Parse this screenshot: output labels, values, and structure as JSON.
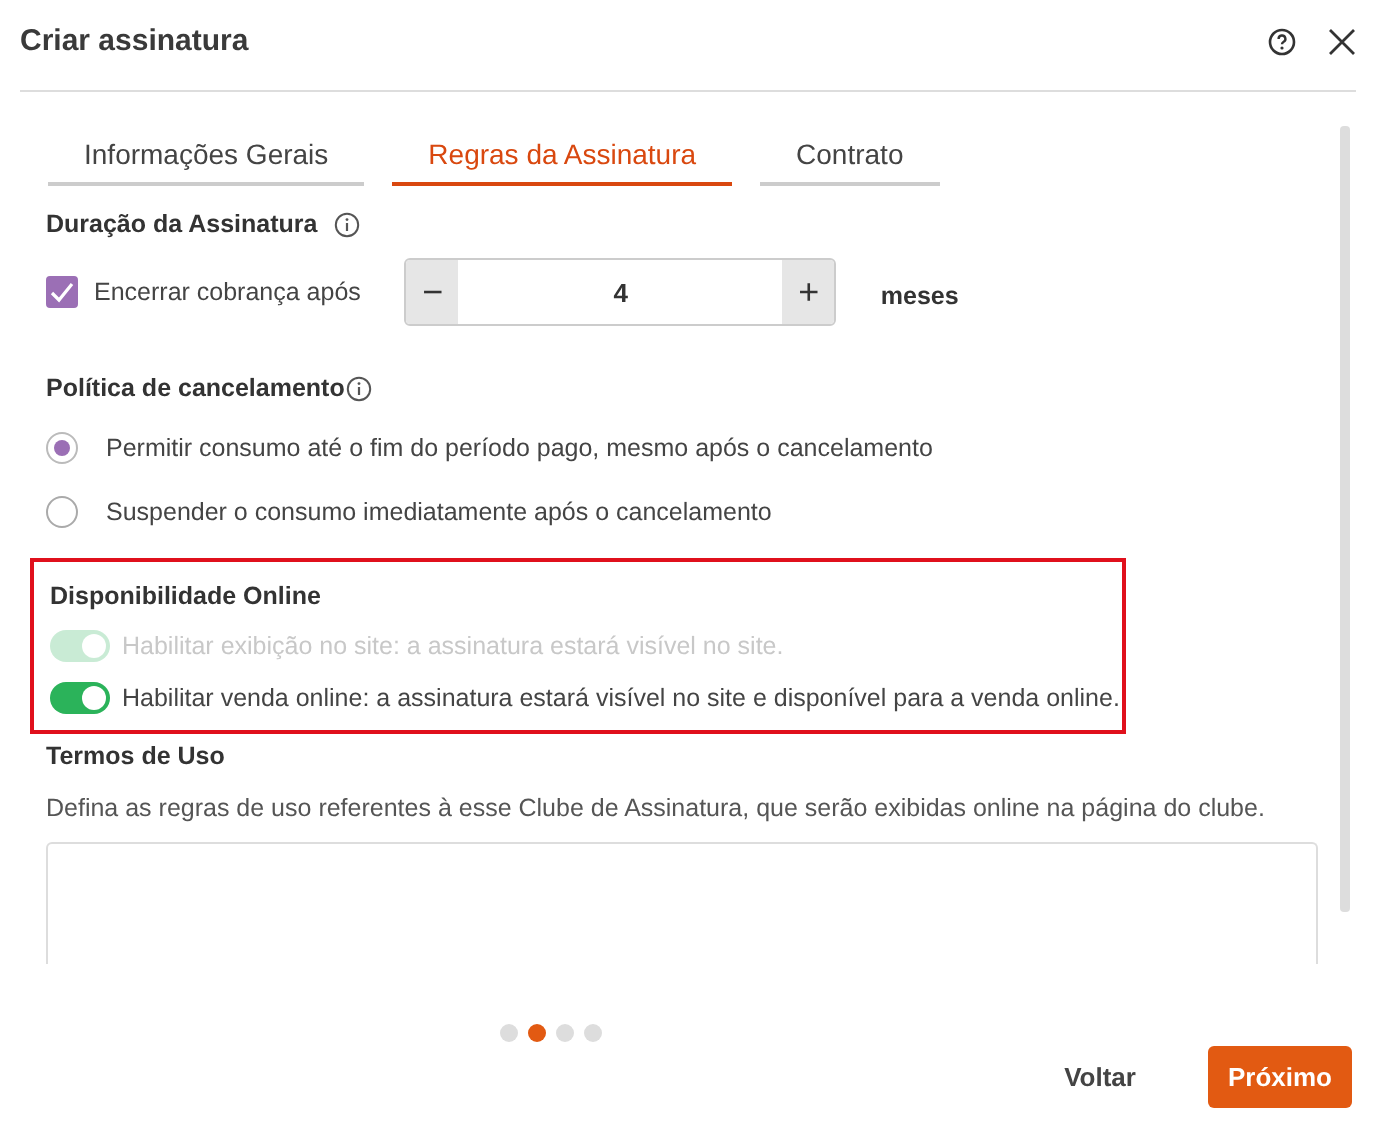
{
  "window": {
    "title": "Criar assinatura"
  },
  "tabs": [
    {
      "label": "Informações Gerais",
      "selected": false
    },
    {
      "label": "Regras da Assinatura",
      "selected": true
    },
    {
      "label": "Contrato",
      "selected": false
    }
  ],
  "duration": {
    "heading": "Duração da Assinatura",
    "checkbox": {
      "label": "Encerrar cobrança após",
      "checked": true
    },
    "minus": "−",
    "value": "4",
    "plus": "+",
    "unit": "meses"
  },
  "cancellation": {
    "heading": "Política de cancelamento",
    "options": [
      {
        "label": "Permitir consumo até o fim do período pago, mesmo após o cancelamento",
        "selected": true
      },
      {
        "label": "Suspender o consumo imediatamente após o cancelamento",
        "selected": false
      }
    ]
  },
  "online": {
    "heading": "Disponibilidade Online",
    "highlighted": true,
    "toggles": [
      {
        "label": "Habilitar exibição no site: a assinatura estará visível no site.",
        "on": true,
        "disabled": true
      },
      {
        "label": "Habilitar venda online: a assinatura estará visível no site e disponível para a venda online.",
        "on": true,
        "disabled": false
      }
    ]
  },
  "terms": {
    "heading": "Termos de Uso",
    "description": "Defina as regras de uso referentes à esse Clube de Assinatura, que serão exibidas online na página do clube."
  },
  "pagination": [
    {
      "selected": false
    },
    {
      "selected": true
    },
    {
      "selected": false
    },
    {
      "selected": false
    }
  ],
  "buttons": {
    "back": "Voltar",
    "next": "Próximo"
  }
}
